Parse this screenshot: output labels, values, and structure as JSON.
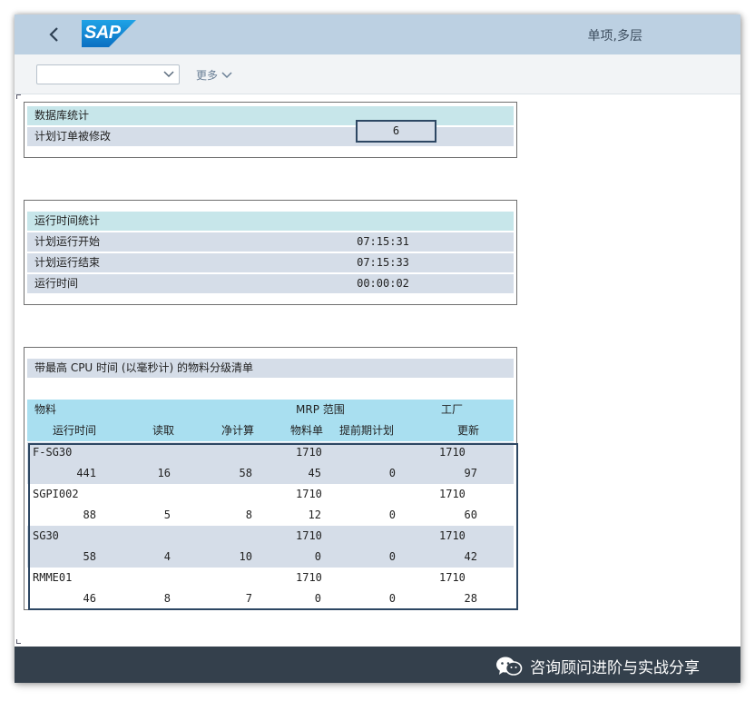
{
  "header": {
    "logo_text": "SAP",
    "title": "单项,多层"
  },
  "toolbar": {
    "variant_value": "",
    "more_label": "更多"
  },
  "db_stats": {
    "title": "数据库统计",
    "rows": [
      {
        "label": "计划订单被修改",
        "value": "6"
      }
    ]
  },
  "runtime_stats": {
    "title": "运行时间统计",
    "rows": [
      {
        "label": "计划运行开始",
        "value": "07:15:31"
      },
      {
        "label": "计划运行结束",
        "value": "07:15:33"
      },
      {
        "label": "运行时间",
        "value": "00:00:02"
      }
    ]
  },
  "material_list": {
    "title": "带最高 CPU 时间 (以毫秒计) 的物料分级清单",
    "header_row1": {
      "material": "物料",
      "mrp_area": "MRP 范围",
      "plant": "工厂"
    },
    "header_row2": {
      "runtime": "运行时间",
      "read": "读取",
      "net_calc": "净计算",
      "bom": "物料单",
      "lead_plan": "提前期计划",
      "update": "更新"
    },
    "items": [
      {
        "material": "F-SG30",
        "mrp_area": "1710",
        "plant": "1710",
        "runtime": "441",
        "read": "16",
        "net_calc": "58",
        "bom": "45",
        "lead_plan": "0",
        "update": "97"
      },
      {
        "material": "SGPI002",
        "mrp_area": "1710",
        "plant": "1710",
        "runtime": "88",
        "read": "5",
        "net_calc": "8",
        "bom": "12",
        "lead_plan": "0",
        "update": "60"
      },
      {
        "material": "SG30",
        "mrp_area": "1710",
        "plant": "1710",
        "runtime": "58",
        "read": "4",
        "net_calc": "10",
        "bom": "0",
        "lead_plan": "0",
        "update": "42"
      },
      {
        "material": "RMME01",
        "mrp_area": "1710",
        "plant": "1710",
        "runtime": "46",
        "read": "8",
        "net_calc": "7",
        "bom": "0",
        "lead_plan": "0",
        "update": "28"
      }
    ]
  },
  "footer": {
    "watermark_text": "咨询顾问进阶与实战分享"
  },
  "colors": {
    "header_bg": "#bcd0e2",
    "section_head": "#c7e6ea",
    "row_shade": "#d5dde8",
    "table_header": "#a9dff0",
    "footer_bg": "#34404c",
    "selection_border": "#2d4763"
  },
  "icons": {
    "back": "chevron-left-icon",
    "dropdown": "chevron-down-icon",
    "more": "chevron-down-icon",
    "watermark": "wechat-icon"
  }
}
